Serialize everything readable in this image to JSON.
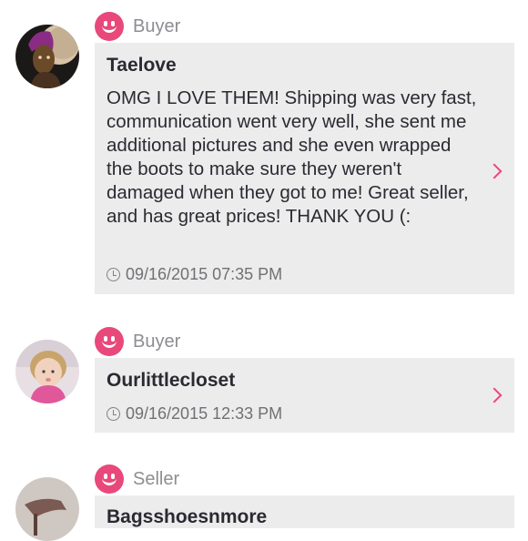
{
  "reviews": [
    {
      "role": "Buyer",
      "username": "Taelove",
      "text": "OMG I LOVE THEM! Shipping was very fast, communication went very well, she sent me additional pictures and she even wrapped the boots to make sure they weren't damaged when they got to me! Great seller, and has great prices! THANK YOU (:",
      "date": "09/16/2015 07:35 PM"
    },
    {
      "role": "Buyer",
      "username": "Ourlittlecloset",
      "text": "",
      "date": "09/16/2015 12:33 PM"
    },
    {
      "role": "Seller",
      "username": "Bagsshoesnmore",
      "text": "",
      "date": ""
    }
  ],
  "icons": {
    "role": "smiley-icon",
    "date": "clock-icon",
    "expand": "chevron-right-icon"
  },
  "colors": {
    "accent": "#e9487a",
    "bubble": "#ececec",
    "text": "#2a2a32",
    "muted": "#8d8d92"
  }
}
